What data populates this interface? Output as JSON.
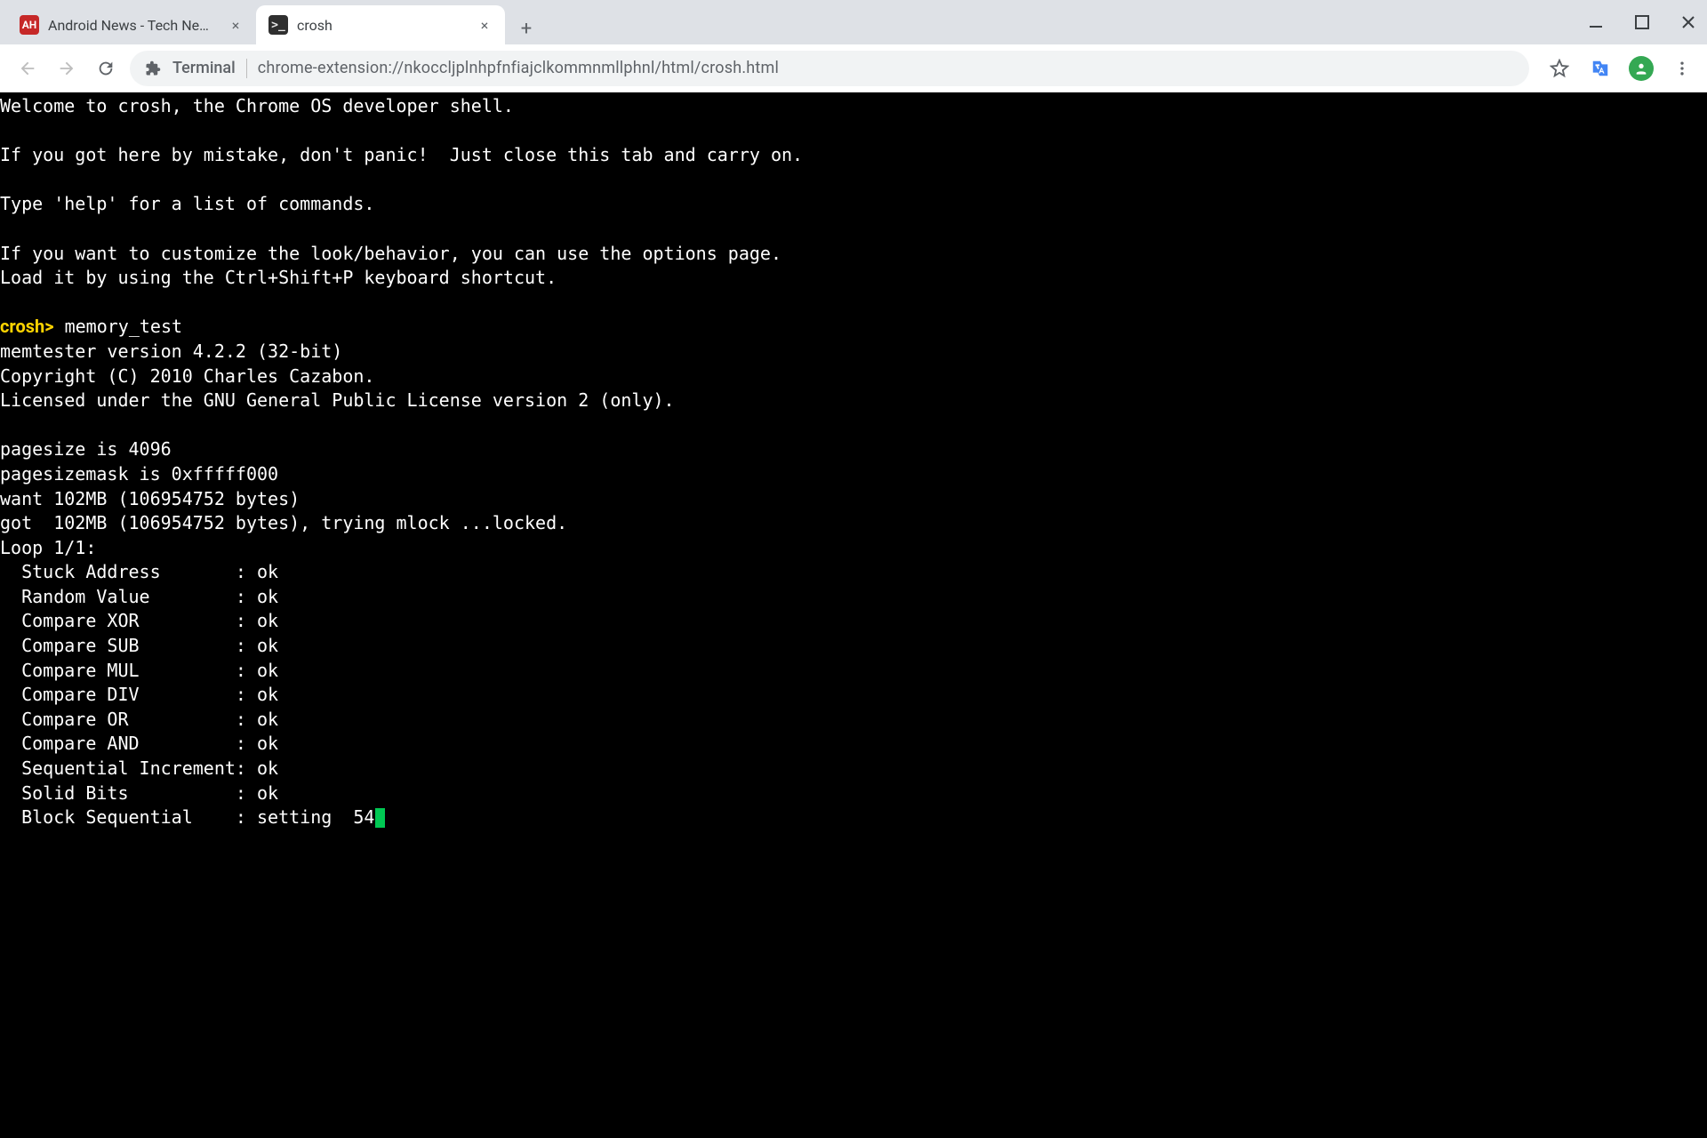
{
  "tabs": [
    {
      "title": "Android News - Tech News - And",
      "favicon_text": "AH",
      "active": false
    },
    {
      "title": "crosh",
      "favicon_text": ">_",
      "active": true
    }
  ],
  "omnibox": {
    "ext_label": "Terminal",
    "url": "chrome-extension://nkoccljplnhpfnfiajclkommnmllphnl/html/crosh.html"
  },
  "terminal": {
    "intro": [
      "Welcome to crosh, the Chrome OS developer shell.",
      "",
      "If you got here by mistake, don't panic!  Just close this tab and carry on.",
      "",
      "Type 'help' for a list of commands.",
      "",
      "If you want to customize the look/behavior, you can use the options page.",
      "Load it by using the Ctrl+Shift+P keyboard shortcut.",
      ""
    ],
    "prompt": "crosh>",
    "command": "memory_test",
    "output_header": [
      "memtester version 4.2.2 (32-bit)",
      "Copyright (C) 2010 Charles Cazabon.",
      "Licensed under the GNU General Public License version 2 (only).",
      "",
      "pagesize is 4096",
      "pagesizemask is 0xfffff000",
      "want 102MB (106954752 bytes)",
      "got  102MB (106954752 bytes), trying mlock ...locked.",
      "Loop 1/1:"
    ],
    "tests": [
      {
        "name": "Stuck Address",
        "status": "ok"
      },
      {
        "name": "Random Value",
        "status": "ok"
      },
      {
        "name": "Compare XOR",
        "status": "ok"
      },
      {
        "name": "Compare SUB",
        "status": "ok"
      },
      {
        "name": "Compare MUL",
        "status": "ok"
      },
      {
        "name": "Compare DIV",
        "status": "ok"
      },
      {
        "name": "Compare OR",
        "status": "ok"
      },
      {
        "name": "Compare AND",
        "status": "ok"
      },
      {
        "name": "Sequential Increment",
        "status": "ok"
      },
      {
        "name": "Solid Bits",
        "status": "ok"
      },
      {
        "name": "Block Sequential",
        "status": "setting  54"
      }
    ]
  },
  "icons": {
    "close_x": "×",
    "plus": "+"
  }
}
